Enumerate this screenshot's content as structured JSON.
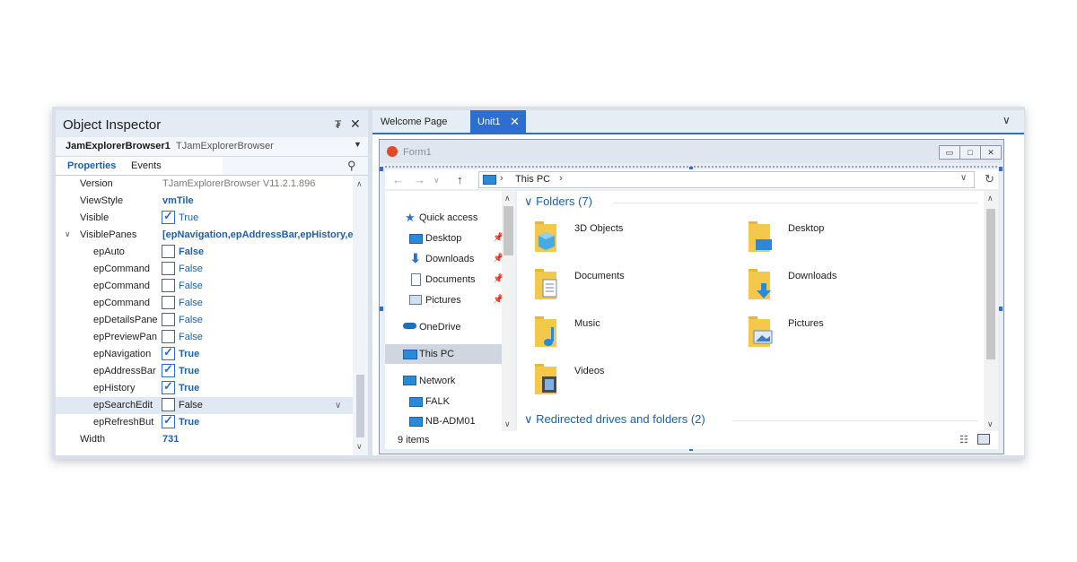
{
  "object_inspector": {
    "title": "Object Inspector",
    "pin_glyph": "₮",
    "close_glyph": "✕",
    "component_name": "JamExplorerBrowser1",
    "component_class": "TJamExplorerBrowser",
    "tabs": [
      "Properties",
      "Events"
    ],
    "properties": [
      {
        "name": "Version",
        "value": "TJamExplorerBrowser V11.2.1.896"
      },
      {
        "name": "ViewStyle",
        "value": "vmTile"
      },
      {
        "name": "Visible",
        "value": "True",
        "checked": true
      },
      {
        "name": "VisiblePanes",
        "value": "[epNavigation,epAddressBar,epHistory,e"
      },
      {
        "name": "epAuto",
        "value": "False",
        "checked": false
      },
      {
        "name": "epCommand",
        "value": "False",
        "checked": false
      },
      {
        "name": "epCommand",
        "value": "False",
        "checked": false
      },
      {
        "name": "epCommand",
        "value": "False",
        "checked": false
      },
      {
        "name": "epDetailsPane",
        "value": "False",
        "checked": false
      },
      {
        "name": "epPreviewPan",
        "value": "False",
        "checked": false
      },
      {
        "name": "epNavigation",
        "value": "True",
        "checked": true
      },
      {
        "name": "epAddressBar",
        "value": "True",
        "checked": true
      },
      {
        "name": "epHistory",
        "value": "True",
        "checked": true
      },
      {
        "name": "epSearchEdit",
        "value": "False",
        "checked": false
      },
      {
        "name": "epRefreshBut",
        "value": "True",
        "checked": true
      },
      {
        "name": "Width",
        "value": "731"
      }
    ]
  },
  "designer": {
    "tabs": [
      "Welcome Page",
      "Unit1"
    ],
    "tab_close": "✕",
    "chevron": "∨",
    "form_title": "Form1",
    "form_buttons": [
      "▭",
      "□",
      "✕"
    ],
    "nav_buttons": [
      "←",
      "→",
      "∨",
      "↑"
    ],
    "address": {
      "sep1": "›",
      "location": "This PC",
      "sep2": "›",
      "dropdown": "∨"
    },
    "refresh": "↻",
    "nav_items": [
      {
        "label": "Quick access",
        "icon": "star-icon"
      },
      {
        "label": "Desktop",
        "icon": "desktop-icon",
        "pin": "📌"
      },
      {
        "label": "Downloads",
        "icon": "download-icon",
        "pin": "📌"
      },
      {
        "label": "Documents",
        "icon": "document-icon",
        "pin": "📌"
      },
      {
        "label": "Pictures",
        "icon": "pictures-icon",
        "pin": "📌"
      },
      {
        "label": "OneDrive",
        "icon": "cloud-icon"
      },
      {
        "label": "This PC",
        "icon": "computer-icon",
        "selected": true
      },
      {
        "label": "Network",
        "icon": "network-icon"
      },
      {
        "label": "FALK",
        "icon": "monitor-icon"
      },
      {
        "label": "NB-ADM01",
        "icon": "monitor-icon"
      }
    ],
    "groups": {
      "folders": "Folders (7)",
      "redirected": "Redirected drives and folders (2)"
    },
    "folders": [
      "3D Objects",
      "Desktop",
      "Documents",
      "Downloads",
      "Music",
      "Pictures",
      "Videos"
    ],
    "status": "9 items",
    "colors": {
      "accent": "#2c6fd0",
      "folder": "#f4c84a",
      "link": "#1a5fb4"
    }
  }
}
